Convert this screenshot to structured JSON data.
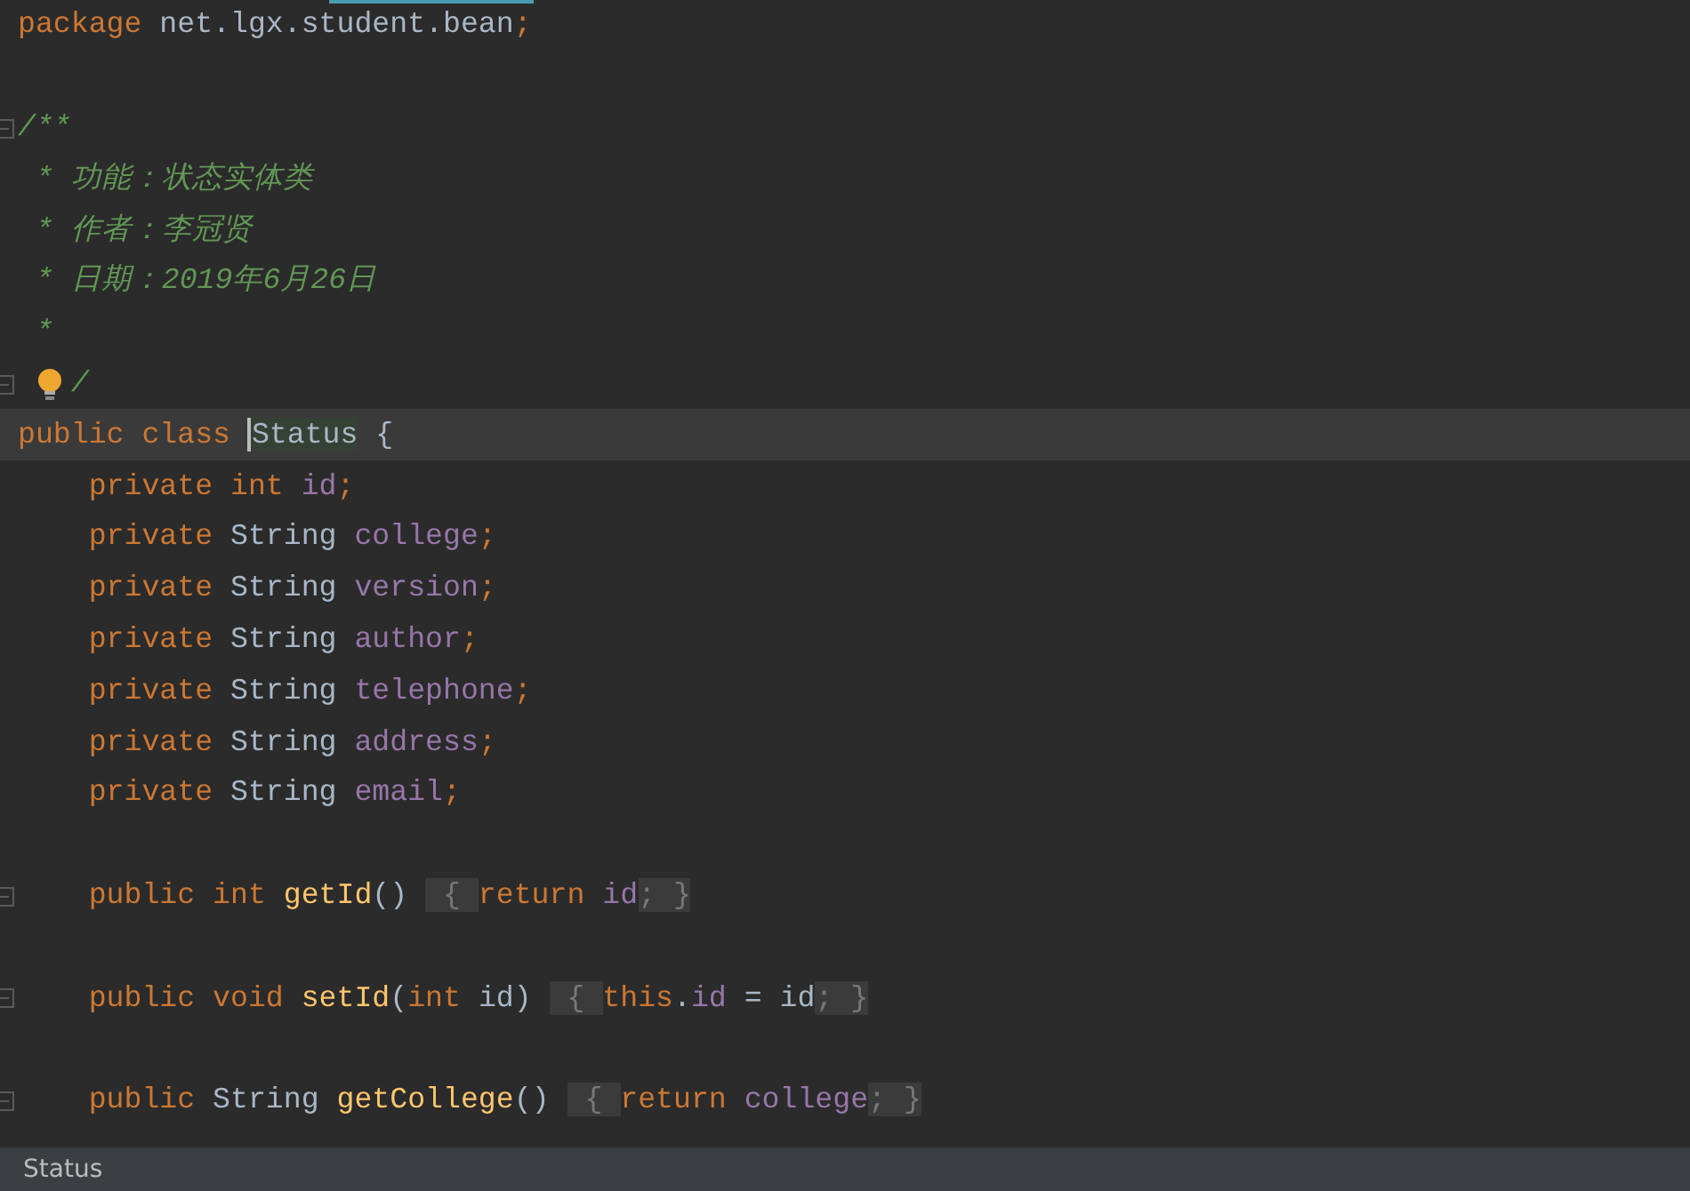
{
  "editor": {
    "lines": [
      {
        "current": false,
        "fold_marker": false,
        "bulb": false,
        "tokens": [
          {
            "kind": "keyword",
            "text": "package "
          },
          {
            "kind": "ident",
            "text": "net.lgx.student.bean"
          },
          {
            "kind": "keyword",
            "text": ";"
          }
        ]
      },
      {
        "current": false,
        "fold_marker": false,
        "bulb": false
      },
      {
        "current": false,
        "fold_marker": true,
        "bulb": false,
        "tokens": [
          {
            "kind": "comment",
            "text": "/**"
          }
        ]
      },
      {
        "current": false,
        "fold_marker": false,
        "bulb": false,
        "tokens": [
          {
            "kind": "comment",
            "text": " * 功能：状态实体类"
          }
        ]
      },
      {
        "current": false,
        "fold_marker": false,
        "bulb": false,
        "tokens": [
          {
            "kind": "comment",
            "text": " * 作者：李冠贤"
          }
        ]
      },
      {
        "current": false,
        "fold_marker": false,
        "bulb": false,
        "tokens": [
          {
            "kind": "comment",
            "text": " * 日期：2019年6月26日"
          }
        ]
      },
      {
        "current": false,
        "fold_marker": false,
        "bulb": false,
        "tokens": [
          {
            "kind": "comment",
            "text": " *"
          }
        ]
      },
      {
        "current": false,
        "fold_marker": true,
        "bulb": true,
        "tokens": [
          {
            "kind": "comment",
            "text": "/"
          }
        ]
      },
      {
        "current": true,
        "fold_marker": false,
        "bulb": false,
        "tokens": [
          {
            "kind": "keyword",
            "text": "public class "
          },
          {
            "kind": "match",
            "text": "Status"
          },
          {
            "kind": "ident",
            "text": " {"
          }
        ]
      },
      {
        "current": false,
        "fold_marker": false,
        "bulb": false,
        "tokens": [
          {
            "kind": "keyword",
            "text": "    private int "
          },
          {
            "kind": "field",
            "text": "id"
          },
          {
            "kind": "keyword",
            "text": ";"
          }
        ]
      },
      {
        "current": false,
        "fold_marker": false,
        "bulb": false,
        "tokens": [
          {
            "kind": "keyword",
            "text": "    private "
          },
          {
            "kind": "ident",
            "text": "String "
          },
          {
            "kind": "field",
            "text": "college"
          },
          {
            "kind": "keyword",
            "text": ";"
          }
        ]
      },
      {
        "current": false,
        "fold_marker": false,
        "bulb": false,
        "tokens": [
          {
            "kind": "keyword",
            "text": "    private "
          },
          {
            "kind": "ident",
            "text": "String "
          },
          {
            "kind": "field",
            "text": "version"
          },
          {
            "kind": "keyword",
            "text": ";"
          }
        ]
      },
      {
        "current": false,
        "fold_marker": false,
        "bulb": false,
        "tokens": [
          {
            "kind": "keyword",
            "text": "    private "
          },
          {
            "kind": "ident",
            "text": "String "
          },
          {
            "kind": "field",
            "text": "author"
          },
          {
            "kind": "keyword",
            "text": ";"
          }
        ]
      },
      {
        "current": false,
        "fold_marker": false,
        "bulb": false,
        "tokens": [
          {
            "kind": "keyword",
            "text": "    private "
          },
          {
            "kind": "ident",
            "text": "String "
          },
          {
            "kind": "field",
            "text": "telephone"
          },
          {
            "kind": "keyword",
            "text": ";"
          }
        ]
      },
      {
        "current": false,
        "fold_marker": false,
        "bulb": false,
        "tokens": [
          {
            "kind": "keyword",
            "text": "    private "
          },
          {
            "kind": "ident",
            "text": "String "
          },
          {
            "kind": "field",
            "text": "address"
          },
          {
            "kind": "keyword",
            "text": ";"
          }
        ]
      },
      {
        "current": false,
        "fold_marker": false,
        "bulb": false,
        "tokens": [
          {
            "kind": "keyword",
            "text": "    private "
          },
          {
            "kind": "ident",
            "text": "String "
          },
          {
            "kind": "field",
            "text": "email"
          },
          {
            "kind": "keyword",
            "text": ";"
          }
        ]
      },
      {
        "current": false,
        "fold_marker": false,
        "bulb": false
      },
      {
        "current": false,
        "fold_marker": true,
        "bulb": false,
        "tokens": [
          {
            "kind": "keyword",
            "text": "    public int "
          },
          {
            "kind": "method",
            "text": "getId"
          },
          {
            "kind": "ident",
            "text": "() "
          },
          {
            "kind": "folded",
            "text": " { "
          },
          {
            "kind": "keyword",
            "text": "return "
          },
          {
            "kind": "field",
            "text": "id"
          },
          {
            "kind": "folded",
            "text": "; }"
          }
        ]
      },
      {
        "current": false,
        "fold_marker": false,
        "bulb": false
      },
      {
        "current": false,
        "fold_marker": true,
        "bulb": false,
        "tokens": [
          {
            "kind": "keyword",
            "text": "    public void "
          },
          {
            "kind": "method",
            "text": "setId"
          },
          {
            "kind": "ident",
            "text": "("
          },
          {
            "kind": "keyword",
            "text": "int "
          },
          {
            "kind": "ident",
            "text": "id) "
          },
          {
            "kind": "folded",
            "text": " { "
          },
          {
            "kind": "keyword",
            "text": "this"
          },
          {
            "kind": "ident",
            "text": "."
          },
          {
            "kind": "field",
            "text": "id"
          },
          {
            "kind": "ident",
            "text": " = id"
          },
          {
            "kind": "folded",
            "text": "; }"
          }
        ]
      },
      {
        "current": false,
        "fold_marker": false,
        "bulb": false
      },
      {
        "current": false,
        "fold_marker": true,
        "bulb": false,
        "tokens": [
          {
            "kind": "keyword",
            "text": "    public "
          },
          {
            "kind": "ident",
            "text": "String "
          },
          {
            "kind": "method",
            "text": "getCollege"
          },
          {
            "kind": "ident",
            "text": "() "
          },
          {
            "kind": "folded",
            "text": " { "
          },
          {
            "kind": "keyword",
            "text": "return "
          },
          {
            "kind": "field",
            "text": "college"
          },
          {
            "kind": "folded",
            "text": "; }"
          }
        ]
      }
    ]
  },
  "status_bar": {
    "breadcrumb": "Status"
  }
}
